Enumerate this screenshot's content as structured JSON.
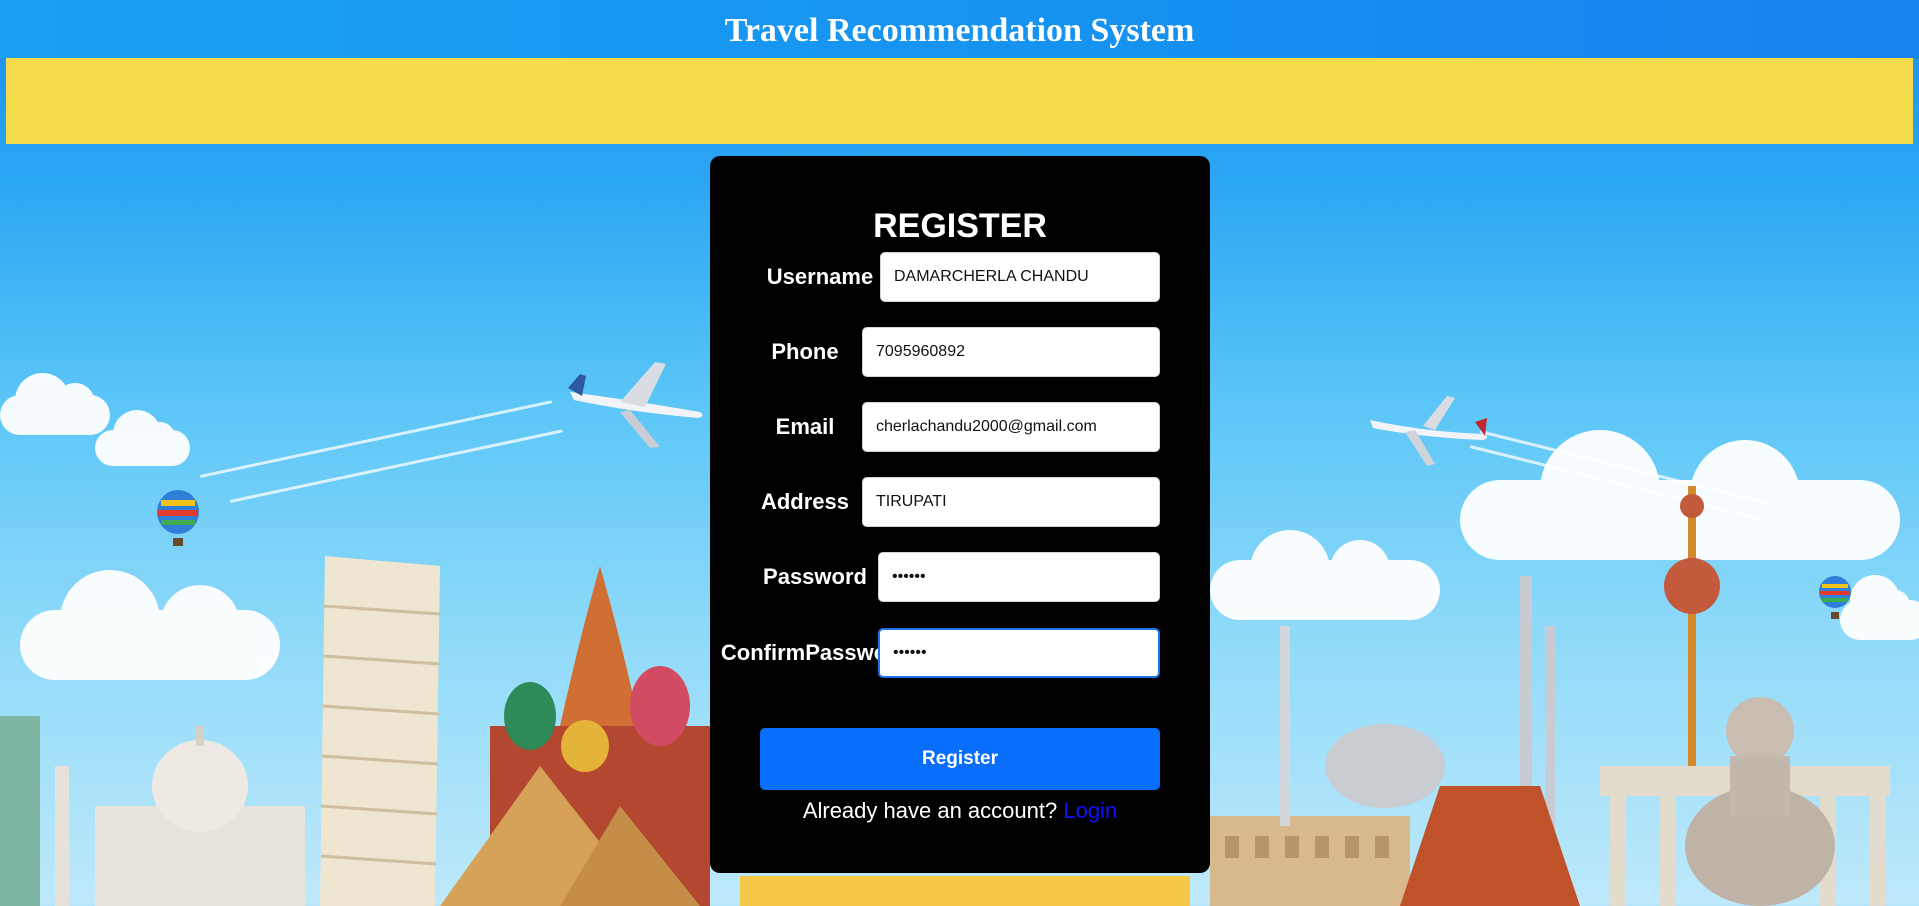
{
  "header": {
    "title": "Travel Recommendation System",
    "color": "#1a96f2",
    "banner_color": "#f4db4c"
  },
  "form": {
    "title": "REGISTER",
    "fields": {
      "username": {
        "label": "Username",
        "value": "DAMARCHERLA CHANDU"
      },
      "phone": {
        "label": "Phone",
        "value": "7095960892"
      },
      "email": {
        "label": "Email",
        "value": "cherlachandu2000@gmail.com"
      },
      "address": {
        "label": "Address",
        "value": "TIRUPATI"
      },
      "password": {
        "label": "Password",
        "value": "••••••"
      },
      "confirm_password": {
        "label_line1": "Confirm",
        "label_line2": "Password",
        "value": "••••••"
      }
    },
    "submit_label": "Register",
    "login_prompt": "Already have an account?",
    "login_link": "Login",
    "accent_color": "#0a6efd"
  }
}
